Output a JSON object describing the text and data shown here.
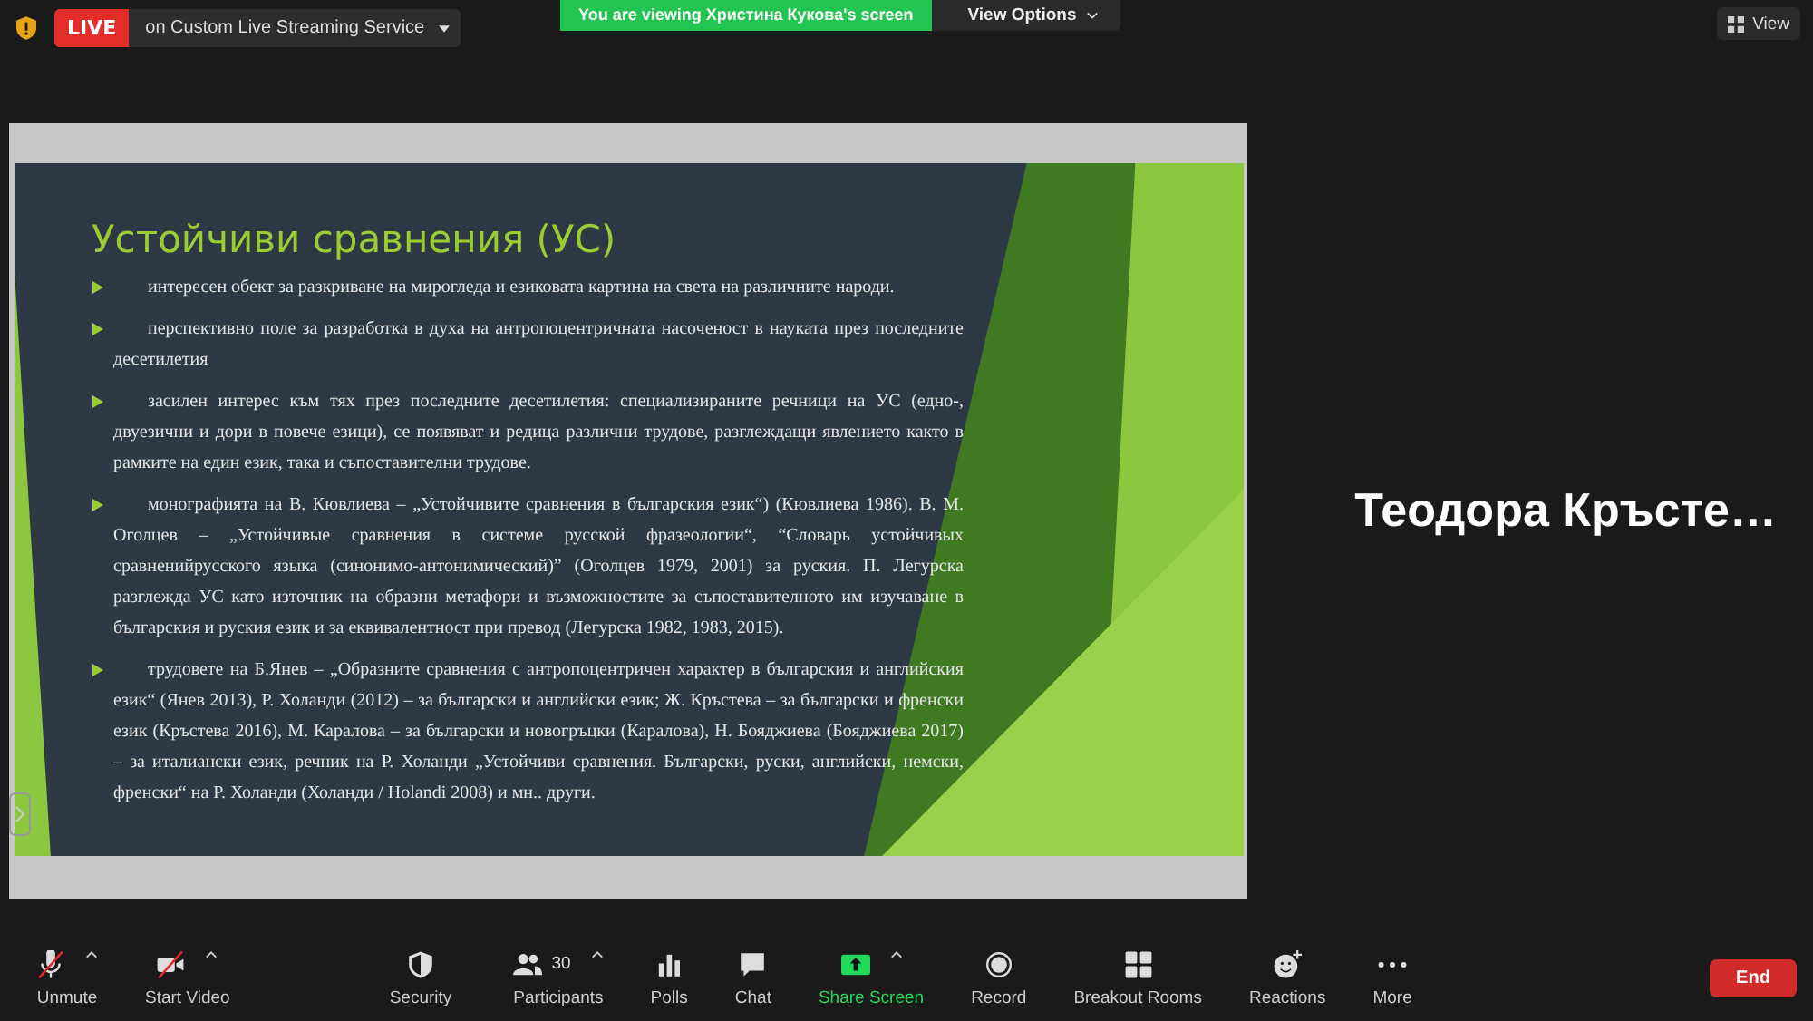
{
  "top_bar": {
    "live_badge": "LIVE",
    "stream_target": "on Custom Live Streaming Service",
    "viewing_banner": "You are viewing Христина Кукова's screen",
    "view_options": "View Options",
    "view_button": "View"
  },
  "slide": {
    "title": "Устойчиви сравнения (УС)",
    "bullets": [
      "интересен обект за разкриване на мирогледа и езиковата картина на света на различните народи.",
      "перспективно поле за разработка в духа на антропоцентричната насоченост в науката през последните десетилетия",
      "засилен интерес към тях през последните десетилетия: специализираните речници на УС (едно-, двуезични и дори в повече езици), се появяват и редица различни трудове, разглеждащи явлението както в рамките на един език, така и съпоставителни трудове.",
      "монографията на В. Кювлиева – „Устойчивите сравнения в българския език“) (Кювлиева 1986). В. М. Оголцев – „Устойчивые сравнения в системе русской фразеологии“, “Словарь устойчивых сравненийрусского языка (синонимо-антонимический)” (Оголцев 1979, 2001) за руския. П. Легурска разглежда УС като източник на образни метафори и възможностите за съпоставителното им изучаване в българския и руския език и за еквивалентност при превод (Легурска 1982, 1983, 2015).",
      "трудовете на Б.Янев – „Образните сравнения с антропоцентричен характер в българския и английския език“ (Янев 2013), Р. Холанди (2012) – за български и английски език; Ж. Кръстева – за български и френски език (Кръстева 2016), М. Каралова – за български и новогръцки (Каралова), Н. Бояджиева (Бояджиева 2017) – за италиански език, речник на Р. Холанди „Устойчиви сравнения. Български, руски, английски, немски, френски“ на Р. Холанди (Холанди / Holandi 2008) и мн.. други."
    ]
  },
  "participant_name": "Теодора Кръсте…",
  "toolbar": [
    {
      "label": "Unmute",
      "off": true,
      "caret": true,
      "active": false
    },
    {
      "label": "Start Video",
      "off": true,
      "caret": true,
      "active": false
    },
    {
      "label": "Security",
      "off": false,
      "caret": false,
      "active": false
    },
    {
      "label": "Participants",
      "count": "30",
      "off": false,
      "caret": true,
      "active": false
    },
    {
      "label": "Polls",
      "off": false,
      "caret": false,
      "active": false
    },
    {
      "label": "Chat",
      "off": false,
      "caret": false,
      "active": false
    },
    {
      "label": "Share Screen",
      "off": false,
      "caret": true,
      "active": true
    },
    {
      "label": "Record",
      "off": false,
      "caret": false,
      "active": false
    },
    {
      "label": "Breakout Rooms",
      "off": false,
      "caret": false,
      "active": false
    },
    {
      "label": "Reactions",
      "off": false,
      "caret": false,
      "active": false
    },
    {
      "label": "More",
      "off": false,
      "caret": false,
      "active": false
    }
  ],
  "end_button": "End"
}
